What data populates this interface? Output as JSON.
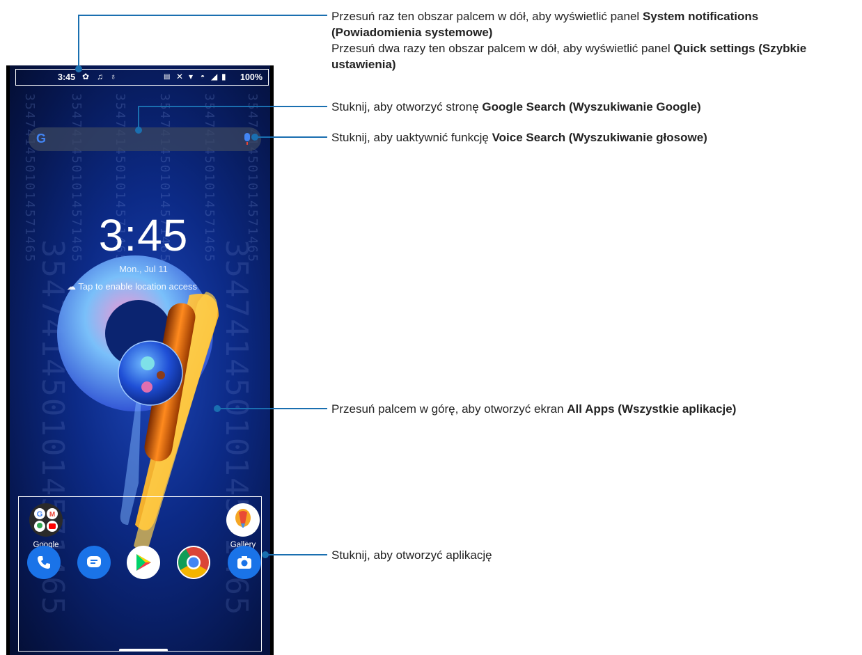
{
  "status_bar": {
    "time": "3:45",
    "battery": "100%"
  },
  "home": {
    "clock": "3:45",
    "date": "Mon., Jul 11",
    "weather_hint": "Tap to enable location access",
    "wallpaper_number": "3547414501014571465"
  },
  "apps": {
    "google_folder_label": "Google",
    "gallery_label": "Gallery"
  },
  "dock": [
    "phone-icon",
    "messages-icon",
    "play-store-icon",
    "chrome-icon",
    "camera-icon"
  ],
  "annotations": {
    "notifications": {
      "line1_pre": "Przesuń raz ten obszar palcem w dół, aby wyświetlić panel ",
      "line1_bold": "System notifications (Powiadomienia systemowe)",
      "line2_pre": "Przesuń dwa razy ten obszar palcem w dół, aby wyświetlić panel ",
      "line2_bold": "Quick settings (Szybkie ustawienia)"
    },
    "google_search": {
      "pre": "Stuknij, aby otworzyć stronę ",
      "bold": "Google Search (Wyszukiwanie Google)"
    },
    "voice_search": {
      "pre": "Stuknij, aby uaktywnić funkcję ",
      "bold": "Voice Search (Wyszukiwanie głosowe)"
    },
    "all_apps": {
      "pre": "Przesuń palcem w górę, aby otworzyć ekran ",
      "bold": "All Apps (Wszystkie aplikacje)"
    },
    "open_app": {
      "text": "Stuknij, aby otworzyć aplikację"
    }
  },
  "colors": {
    "callout_line": "#1a6fb0",
    "wallpaper": "#0c2a86",
    "accent_orange": "#f5a623"
  }
}
